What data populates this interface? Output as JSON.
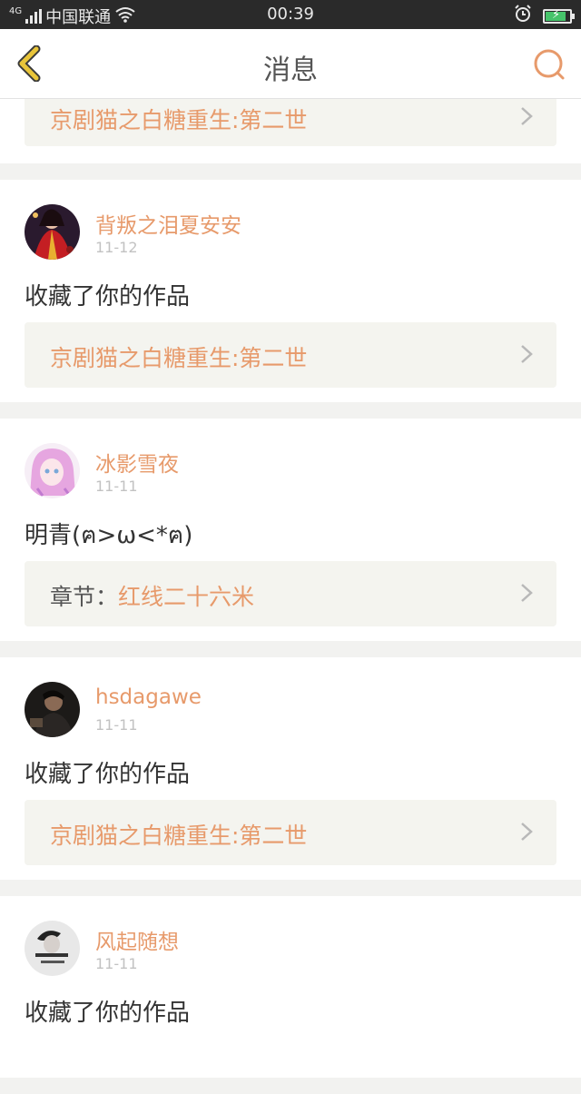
{
  "status_bar": {
    "network_type": "4G",
    "carrier": "中国联通",
    "time": "00:39"
  },
  "header": {
    "title": "消息"
  },
  "colors": {
    "accent": "#e79a6b",
    "back_icon": "#e9c53a",
    "link_bg": "#f4f4ef",
    "battery_fill": "#46c36a"
  },
  "feed": {
    "partial_card": {
      "link": "京剧猫之白糖重生:第二世"
    },
    "items": [
      {
        "username": "背叛之泪夏安安",
        "date": "11-12",
        "message": "收藏了你的作品",
        "link_prefix": "",
        "link": "京剧猫之白糖重生:第二世",
        "avatar_icon": "avatar-red-costume"
      },
      {
        "username": "冰影雪夜",
        "date": "11-11",
        "message": "明青(ฅ>ω<*ฅ)",
        "link_prefix": "章节：",
        "link": "红线二十六米",
        "avatar_icon": "avatar-pink-anime"
      },
      {
        "username": "hsdagawe",
        "date": "11-11",
        "message": "收藏了你的作品",
        "link_prefix": "",
        "link": "京剧猫之白糖重生:第二世",
        "avatar_icon": "avatar-dark-photo"
      },
      {
        "username": "风起随想",
        "date": "11-11",
        "message": "收藏了你的作品",
        "avatar_icon": "avatar-grey-photo"
      }
    ]
  }
}
